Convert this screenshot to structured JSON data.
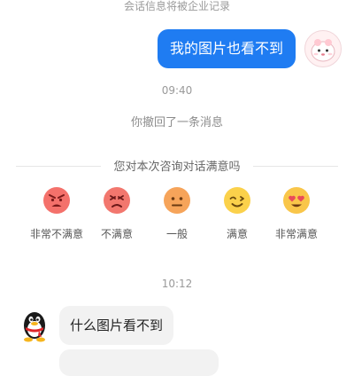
{
  "notice": "会话信息将被企业记录",
  "messages": {
    "outgoing": "我的图片也看不到",
    "time1": "09:40",
    "recall": "你撤回了一条消息",
    "time2": "10:12",
    "incoming": "什么图片看不到"
  },
  "survey": {
    "title": "您对本次咨询对话满意吗",
    "options": [
      {
        "label": "非常不满意",
        "icon": "very-angry-face-icon"
      },
      {
        "label": "不满意",
        "icon": "angry-face-icon"
      },
      {
        "label": "一般",
        "icon": "neutral-face-icon"
      },
      {
        "label": "满意",
        "icon": "smile-face-icon"
      },
      {
        "label": "非常满意",
        "icon": "heart-eyes-face-icon"
      }
    ]
  },
  "colors": {
    "accent": "#1f7cf2",
    "incoming_bubble": "#f2f2f2"
  }
}
